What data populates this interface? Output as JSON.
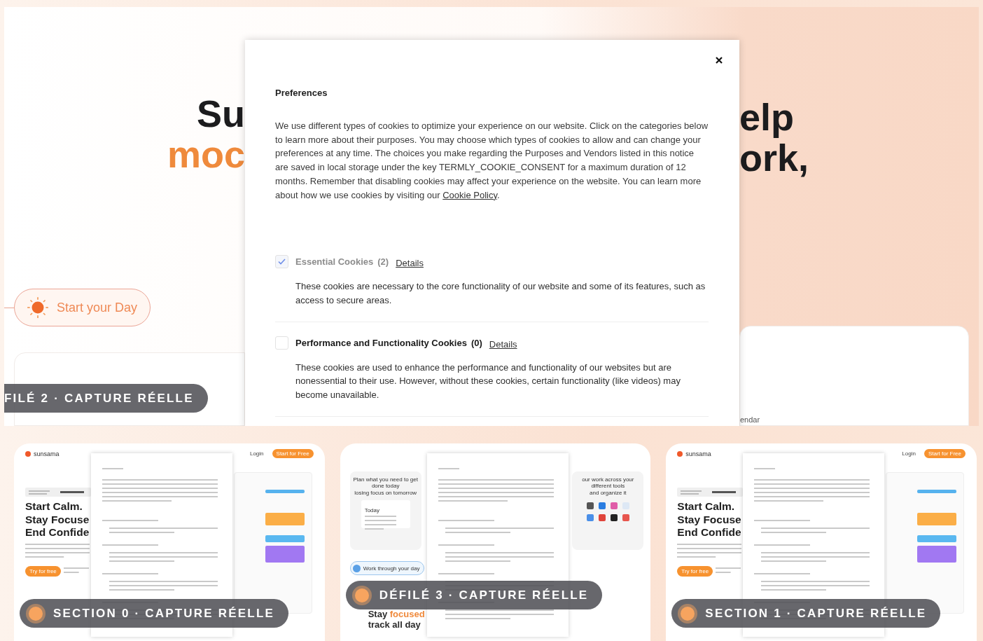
{
  "main_capture": {
    "caption": "FILÉ 2 · CAPTURE RÉELLE",
    "hero_left": [
      "Su",
      "moc"
    ],
    "hero_right": [
      "elp",
      "ork,"
    ],
    "start_pill": "Start your Day",
    "card_label": "endar",
    "modal": {
      "title": "Preferences",
      "intro": "We use different types of cookies to optimize your experience on our website. Click on the categories below to learn more about their purposes. You may choose which types of cookies to allow and can change your preferences at any time. The choices you make regarding the Purposes and Vendors listed in this notice are saved in local storage under the key TERMLY_COOKIE_CONSENT for a maximum duration of 12 months. Remember that disabling cookies may affect your experience on the website. You can learn more about how we use cookies by visiting our",
      "intro_link": "Cookie Policy",
      "intro_end": ".",
      "categories": [
        {
          "name": "Essential Cookies",
          "count": "(2)",
          "link": "Details",
          "checked": true,
          "disabled": true,
          "description": "These cookies are necessary to the core functionality of our website and some of its features, such as access to secure areas."
        },
        {
          "name": "Performance and Functionality Cookies",
          "count": "(0)",
          "link": "Details",
          "checked": false,
          "disabled": false,
          "description": "These cookies are used to enhance the performance and functionality of our websites but are nonessential to their use. However, without these cookies, certain functionality (like videos) may become unavailable."
        }
      ]
    }
  },
  "thumbnails": [
    {
      "kind": "hero",
      "caption": "SECTION 0 · CAPTURE RÉELLE",
      "brand": "sunsama",
      "login": "Login",
      "cta": "Start for Free",
      "headline": [
        "Start Calm.",
        "Stay Focuse",
        "End Confide"
      ],
      "try_button": "Try for free"
    },
    {
      "kind": "features",
      "caption": "DÉFILÉ 3 · CAPTURE RÉELLE",
      "plan_text": [
        "Plan what you need to get done today",
        "losing focus on tomorrow"
      ],
      "today": "Today",
      "tools_text": [
        "our work across your different tools",
        "and organize it"
      ],
      "pill": "Work through your day",
      "heading_plain": "Stay",
      "heading_accent": "focused",
      "heading_line2": "track all day"
    },
    {
      "kind": "hero",
      "caption": "SECTION 1 · CAPTURE RÉELLE",
      "brand": "sunsama",
      "login": "Login",
      "cta": "Start for Free",
      "headline": [
        "Start Calm.",
        "Stay Focuse",
        "End Confide"
      ],
      "try_button": "Try for free"
    }
  ]
}
